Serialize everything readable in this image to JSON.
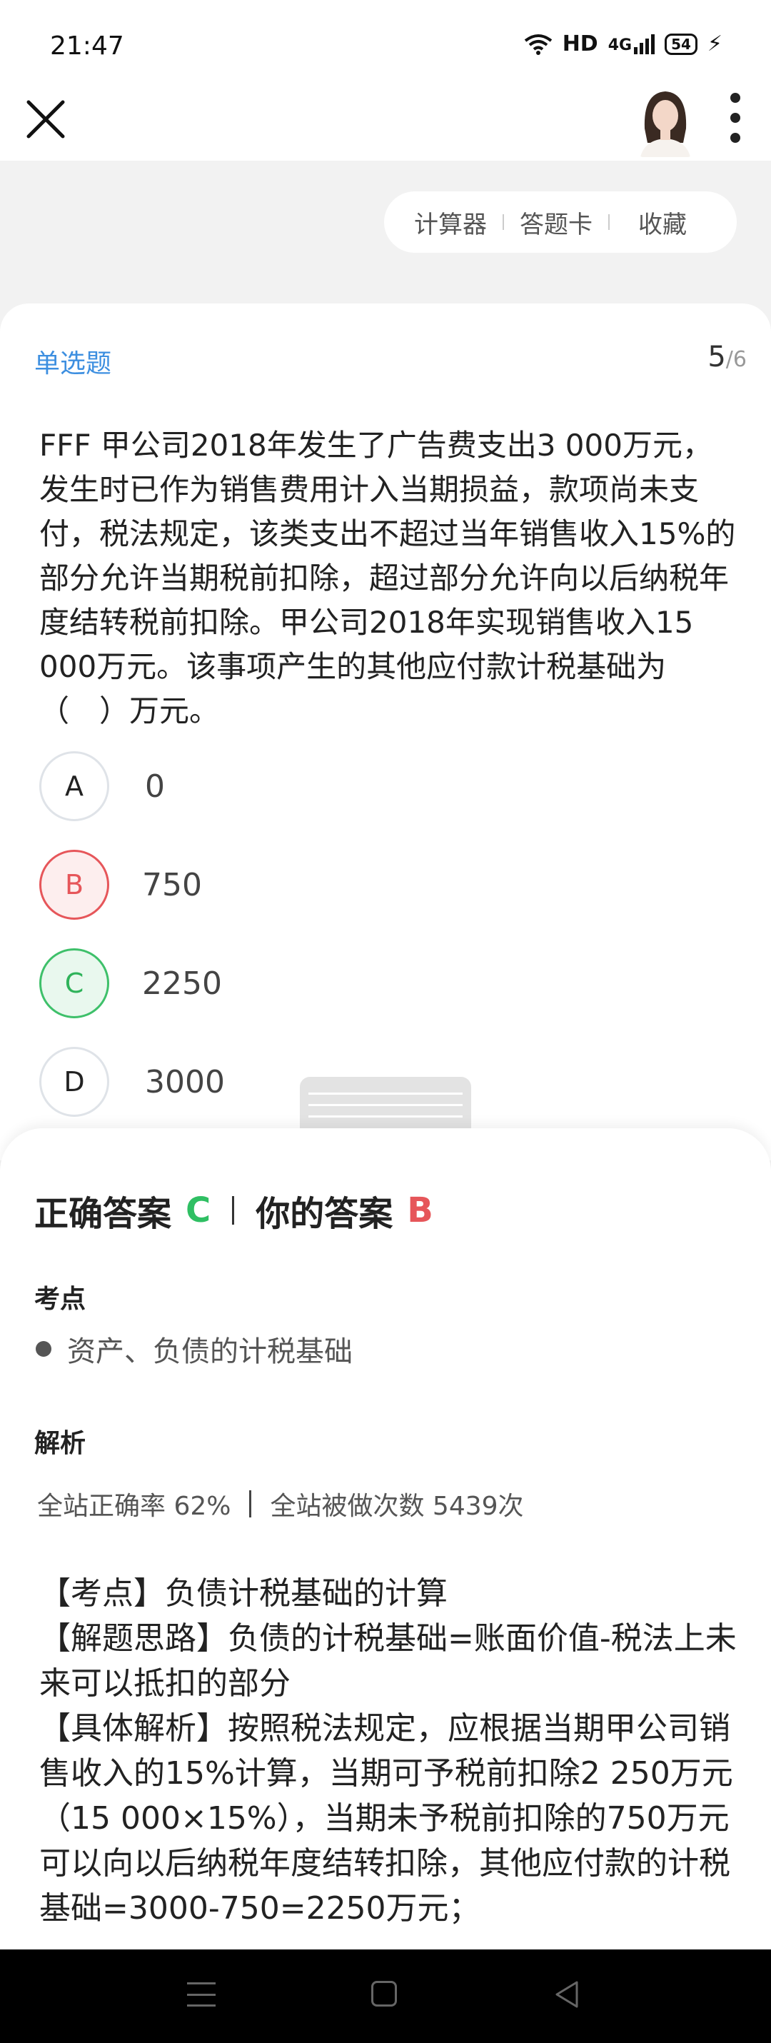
{
  "status_bar": {
    "time": "21:47",
    "network": "HD",
    "signal_type": "4G",
    "battery": "54"
  },
  "toolbar": {
    "calculator": "计算器",
    "answer_card": "答题卡",
    "favorite": "收藏"
  },
  "question": {
    "type": "单选题",
    "current": "5",
    "total": "/6",
    "text": "FFF 甲公司2018年发生了广告费支出3 000万元，发生时已作为销售费用计入当期损益，款项尚未支付，税法规定，该类支出不超过当年销售收入15%的部分允许当期税前扣除，超过部分允许向以后纳税年度结转税前扣除。甲公司2018年实现销售收入15 000万元。该事项产生的其他应付款计税基础为（　）万元。",
    "options": [
      {
        "letter": "A",
        "text": "0",
        "state": "normal"
      },
      {
        "letter": "B",
        "text": "750",
        "state": "wrong"
      },
      {
        "letter": "C",
        "text": "2250",
        "state": "right"
      },
      {
        "letter": "D",
        "text": "3000",
        "state": "normal"
      }
    ]
  },
  "answer": {
    "correct_label": "正确答案",
    "correct": "C",
    "yours_label": "你的答案",
    "yours": "B",
    "point_title": "考点",
    "point": "资产、负债的计税基础",
    "analysis_title": "解析",
    "accuracy": "全站正确率 62%",
    "attempts": "全站被做次数 5439次",
    "explanation": [
      "【考点】负债计税基础的计算",
      "【解题思路】负债的计税基础=账面价值-税法上未来可以抵扣的部分",
      "【具体解析】按照税法规定，应根据当期甲公司销售收入的15%计算，当期可予税前扣除2 250万元（15 000×15%），当期未予税前扣除的750万元可以向以后纳税年度结转扣除，其他应付款的计税基础=3000-750=2250万元；"
    ]
  },
  "colors": {
    "accent_blue": "#3d8fe0",
    "correct_green": "#2fbf63",
    "wrong_red": "#e6565a"
  },
  "icons": [
    "close-icon",
    "avatar",
    "more-icon",
    "wifi-icon",
    "menu-icon",
    "home-icon",
    "back-icon"
  ]
}
